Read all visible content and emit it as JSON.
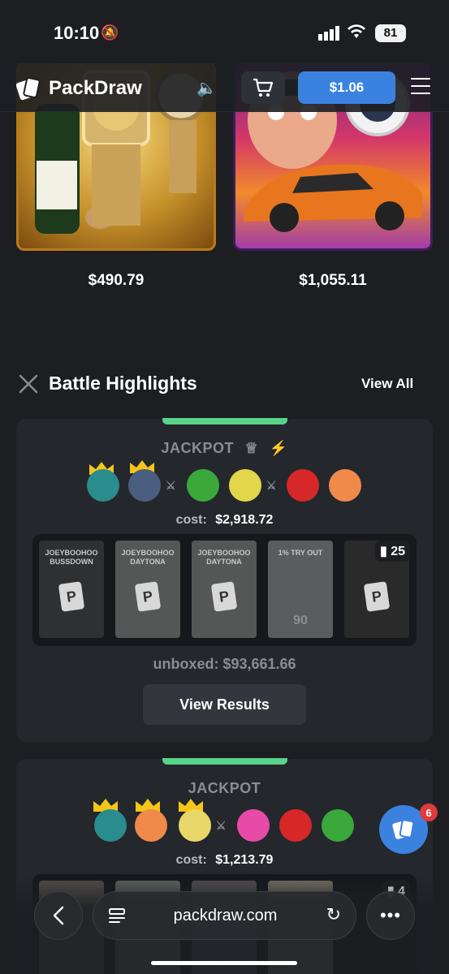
{
  "status_bar": {
    "time": "10:10",
    "battery": "81"
  },
  "header": {
    "brand": "PackDraw",
    "balance": "$1.06"
  },
  "packs": [
    {
      "price": "$490.79"
    },
    {
      "price": "$1,055.11"
    }
  ],
  "section": {
    "title": "Battle Highlights",
    "view_all": "View All"
  },
  "battles": [
    {
      "mode": "JACKPOT",
      "cost_label": "cost:",
      "cost": "$2,918.72",
      "pack_titles": [
        "JOEYBOOHOO BUSSDOWN",
        "JOEYBOOHOO DAYTONA",
        "JOEYBOOHOO DAYTONA",
        "1% TRY OUT",
        ""
      ],
      "try_out_number": "90",
      "pack_count": "25",
      "unboxed": "unboxed: $93,661.66",
      "results_label": "View Results"
    },
    {
      "mode": "JACKPOT",
      "cost_label": "cost:",
      "cost": "$1,213.79",
      "pack_count": "4"
    }
  ],
  "chat": {
    "badge": "6"
  },
  "browser": {
    "url": "packdraw.com"
  },
  "colors": {
    "accent": "#3b82e0",
    "highlight": "#59d38a",
    "badge": "#e03a3a"
  }
}
